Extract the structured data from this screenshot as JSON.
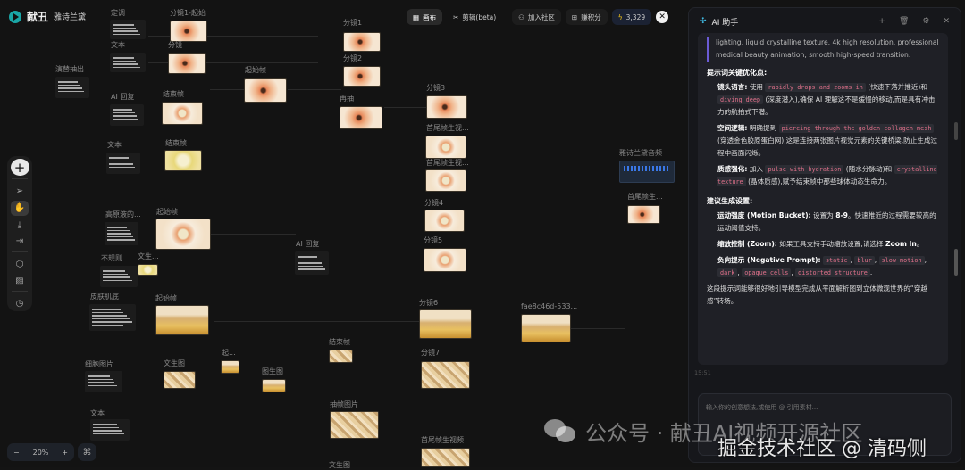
{
  "app": {
    "brand": "献丑",
    "project": "雅诗兰黛"
  },
  "topbar": {
    "canvas": "画布",
    "edit": "剪辑(beta)",
    "community": "加入社区",
    "earn": "赚积分",
    "credits": "3,329"
  },
  "tools": {
    "zoom_level": "20%",
    "zoom_minus": "−",
    "zoom_plus": "+",
    "cmd": "⌘"
  },
  "nodes": [
    {
      "label": "定调",
      "kind": "text"
    },
    {
      "label": "文本",
      "kind": "text"
    },
    {
      "label": "演替抽出",
      "kind": "text"
    },
    {
      "label": "AI 回复",
      "kind": "text"
    },
    {
      "label": "文本",
      "kind": "text"
    },
    {
      "label": "高原液的...",
      "kind": "text"
    },
    {
      "label": "不规则...",
      "kind": "text"
    },
    {
      "label": "皮肤肌底",
      "kind": "text"
    },
    {
      "label": "细胞图片",
      "kind": "text"
    },
    {
      "label": "文本",
      "kind": "text"
    },
    {
      "label": "AI 回复",
      "kind": "text"
    },
    {
      "label": "分镜1-起始",
      "kind": "image"
    },
    {
      "label": "分镜",
      "kind": "image"
    },
    {
      "label": "起始帧",
      "kind": "image"
    },
    {
      "label": "结束帧",
      "kind": "image"
    },
    {
      "label": "结束帧",
      "kind": "image"
    },
    {
      "label": "起始帧",
      "kind": "image"
    },
    {
      "label": "文生...",
      "kind": "image"
    },
    {
      "label": "起始帧",
      "kind": "image"
    },
    {
      "label": "文生图",
      "kind": "image"
    },
    {
      "label": "起...",
      "kind": "image"
    },
    {
      "label": "图生图",
      "kind": "image"
    },
    {
      "label": "分镜1",
      "kind": "image"
    },
    {
      "label": "分镜2",
      "kind": "image"
    },
    {
      "label": "再抽",
      "kind": "image"
    },
    {
      "label": "分镜3",
      "kind": "image"
    },
    {
      "label": "首尾帧生视...",
      "kind": "video"
    },
    {
      "label": "首尾帧生视...",
      "kind": "video"
    },
    {
      "label": "分镜4",
      "kind": "image"
    },
    {
      "label": "分镜5",
      "kind": "image"
    },
    {
      "label": "分镜6",
      "kind": "image"
    },
    {
      "label": "fae8c46d-533...",
      "kind": "image"
    },
    {
      "label": "结束帧",
      "kind": "image"
    },
    {
      "label": "分镜7",
      "kind": "image"
    },
    {
      "label": "抽帧图片",
      "kind": "image"
    },
    {
      "label": "首尾帧生视频",
      "kind": "video"
    },
    {
      "label": "文生图",
      "kind": "image"
    },
    {
      "label": "雅诗兰黛音频",
      "kind": "audio"
    },
    {
      "label": "首尾帧生...",
      "kind": "video"
    }
  ],
  "panel": {
    "title": "AI 助手",
    "quote": "lighting, liquid crystalline texture, 4k high resolution, professional medical beauty animation, smooth high-speed transition.",
    "h1": "提示词关键优化点:",
    "p1_title": "镜头语言:",
    "p1_a": "使用",
    "p1_c1": "rapidly drops and zooms in",
    "p1_b": "(快速下落并推近)和",
    "p1_c2": "diving deep",
    "p1_d": "(深度潜入),确保 AI 理解这不是缓慢的移动,而是具有冲击力的航拍式下潜。",
    "p2_title": "空间逻辑:",
    "p2_a": "明确提到",
    "p2_c1": "piercing through the golden collagen mesh",
    "p2_b": "(穿透金色胶原蛋白网),这是连接两张图片视觉元素的关键桥梁,防止生成过程中画面闪烁。",
    "p3_title": "质感强化:",
    "p3_a": "加入",
    "p3_c1": "pulse with hydration",
    "p3_b": "(随水分脉动)和",
    "p3_c2": "crystalline texture",
    "p3_d": "(晶体质感),赋予结束帧中那些球体动态生命力。",
    "h2": "建议生成设置:",
    "s1_title": "运动强度 (Motion Bucket):",
    "s1_text": "设置为",
    "s1_val": "8-9",
    "s1_rest": "。快速推近的过程需要较高的运动阈值支持。",
    "s2_title": "缩放控制 (Zoom):",
    "s2_text": "如果工具支持手动缩放设置,请选择",
    "s2_val": "Zoom In",
    "s2_end": "。",
    "s3_title": "负向提示 (Negative Prompt):",
    "neg": [
      "static",
      "blur",
      "slow motion",
      "dark",
      "opaque cells",
      "distorted structure"
    ],
    "closing": "这段提示词能够很好地引导模型完成从平面解析图到立体微观世界的“穿越感”转场。",
    "time": "15:51",
    "input_placeholder": "输入你的创意想法,或使用 @ 引用素材..."
  },
  "watermark": {
    "line1": "公众号 · 献丑AI视频开源社区",
    "line2": "掘金技术社区 @ 清码侧"
  }
}
